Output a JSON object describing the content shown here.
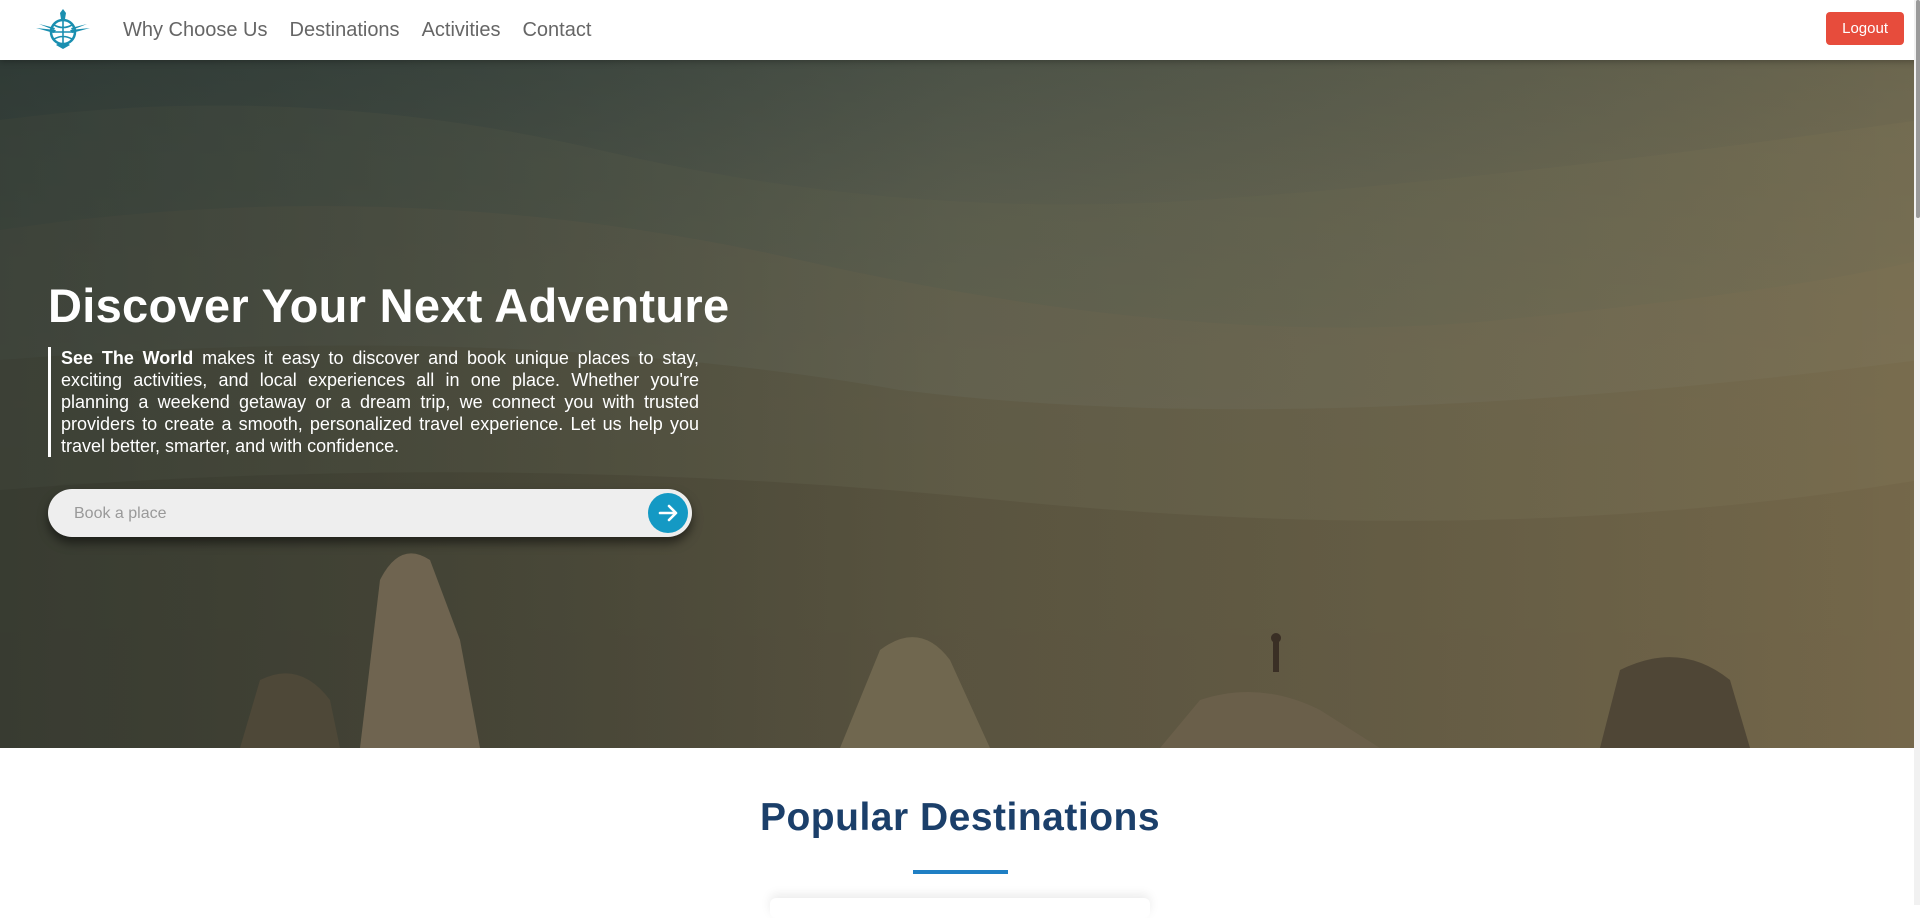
{
  "brand": {
    "logo_icon": "globe-plane-logo-icon",
    "color": "#1a8fb0"
  },
  "nav": {
    "links": [
      "Why Choose Us",
      "Destinations",
      "Activities",
      "Contact"
    ],
    "logout_label": "Logout",
    "logout_color": "#e74c3c"
  },
  "hero": {
    "title": "Discover Your Next Adventure",
    "description_brand": "See The World",
    "description_rest": " makes it easy to discover and book unique places to stay, exciting activities, and local experiences all in one place. Whether you're planning a weekend getaway or a dream trip, we connect you with trusted providers to create a smooth, personalized travel experience. Let us help you travel better, smarter, and with confidence.",
    "search_placeholder": "Book a place",
    "search_button_icon": "arrow-right-icon",
    "search_button_color": "#1499c4"
  },
  "popular": {
    "title": "Popular Destinations",
    "accent_color": "#1f7fc4",
    "title_color": "#1b3f6a"
  }
}
